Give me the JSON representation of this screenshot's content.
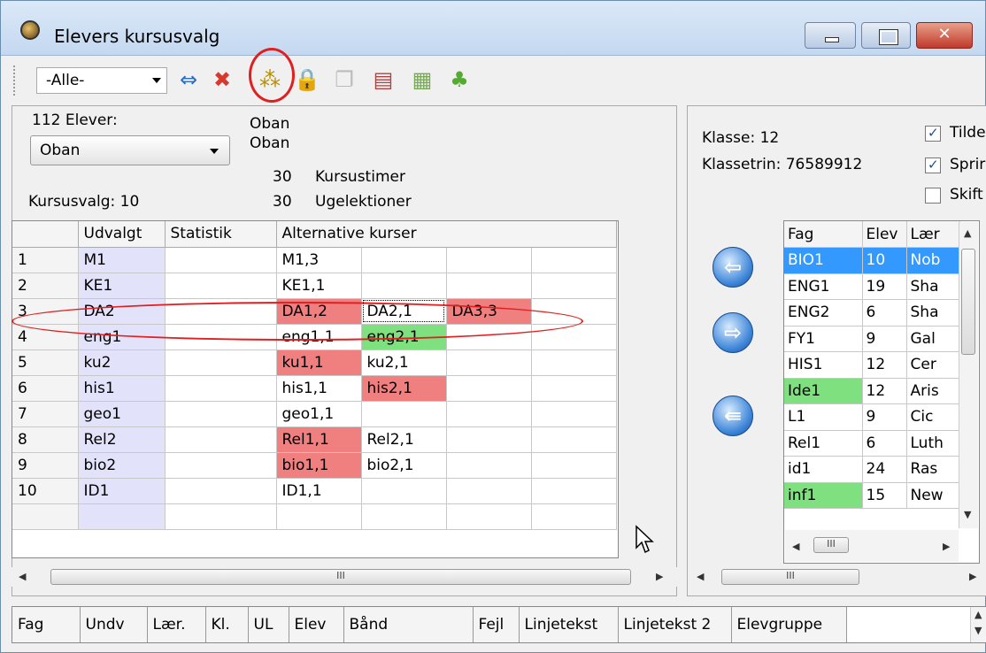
{
  "window": {
    "title": "Elevers kursusvalg",
    "close_glyph": "✕"
  },
  "toolbar": {
    "filter_value": "-Alle-",
    "icons": {
      "swap": "⇔",
      "delete": "✖",
      "stars": "⁂",
      "lock": "🔒",
      "copy": "❐",
      "filter": "▤",
      "grid": "▦",
      "users": "♣"
    }
  },
  "student": {
    "count_label": "112 Elever:",
    "name1": "Oban",
    "name2": "Oban",
    "selected": "Oban",
    "kursustimer_value": "30",
    "kursustimer_label": "Kursustimer",
    "ugelektioner_value": "30",
    "ugelektioner_label": "Ugelektioner",
    "kursusvalg": "Kursusvalg: 10"
  },
  "grid": {
    "headers": [
      "",
      "Udvalgt",
      "Statistik",
      "Alternative kurser",
      "",
      "",
      ""
    ],
    "rows": [
      {
        "n": "1",
        "udv": "M1",
        "alts": [
          {
            "t": "M1,3",
            "c": ""
          },
          {
            "t": "",
            "c": ""
          },
          {
            "t": "",
            "c": ""
          },
          {
            "t": "",
            "c": ""
          }
        ]
      },
      {
        "n": "2",
        "udv": "KE1",
        "alts": [
          {
            "t": "KE1,1",
            "c": ""
          },
          {
            "t": "",
            "c": ""
          },
          {
            "t": "",
            "c": ""
          },
          {
            "t": "",
            "c": ""
          }
        ]
      },
      {
        "n": "3",
        "udv": "DA2",
        "alts": [
          {
            "t": "DA1,2",
            "c": "red"
          },
          {
            "t": "DA2,1",
            "c": "focused"
          },
          {
            "t": "DA3,3",
            "c": "red"
          },
          {
            "t": "",
            "c": ""
          }
        ]
      },
      {
        "n": "4",
        "udv": "eng1",
        "alts": [
          {
            "t": "eng1,1",
            "c": ""
          },
          {
            "t": "eng2,1",
            "c": "green"
          },
          {
            "t": "",
            "c": ""
          },
          {
            "t": "",
            "c": ""
          }
        ]
      },
      {
        "n": "5",
        "udv": "ku2",
        "alts": [
          {
            "t": "ku1,1",
            "c": "red"
          },
          {
            "t": "ku2,1",
            "c": ""
          },
          {
            "t": "",
            "c": ""
          },
          {
            "t": "",
            "c": ""
          }
        ]
      },
      {
        "n": "6",
        "udv": "his1",
        "alts": [
          {
            "t": "his1,1",
            "c": ""
          },
          {
            "t": "his2,1",
            "c": "red"
          },
          {
            "t": "",
            "c": ""
          },
          {
            "t": "",
            "c": ""
          }
        ]
      },
      {
        "n": "7",
        "udv": "geo1",
        "alts": [
          {
            "t": "geo1,1",
            "c": ""
          },
          {
            "t": "",
            "c": ""
          },
          {
            "t": "",
            "c": ""
          },
          {
            "t": "",
            "c": ""
          }
        ]
      },
      {
        "n": "8",
        "udv": "Rel2",
        "alts": [
          {
            "t": "Rel1,1",
            "c": "red"
          },
          {
            "t": "Rel2,1",
            "c": ""
          },
          {
            "t": "",
            "c": ""
          },
          {
            "t": "",
            "c": ""
          }
        ]
      },
      {
        "n": "9",
        "udv": "bio2",
        "alts": [
          {
            "t": "bio1,1",
            "c": "red"
          },
          {
            "t": "bio2,1",
            "c": ""
          },
          {
            "t": "",
            "c": ""
          },
          {
            "t": "",
            "c": ""
          }
        ]
      },
      {
        "n": "10",
        "udv": "ID1",
        "alts": [
          {
            "t": "ID1,1",
            "c": ""
          },
          {
            "t": "",
            "c": ""
          },
          {
            "t": "",
            "c": ""
          },
          {
            "t": "",
            "c": ""
          }
        ]
      },
      {
        "n": "",
        "udv": "",
        "alts": [
          {
            "t": "",
            "c": ""
          },
          {
            "t": "",
            "c": ""
          },
          {
            "t": "",
            "c": ""
          },
          {
            "t": "",
            "c": ""
          }
        ]
      }
    ]
  },
  "scroll": {
    "left": "◀",
    "right": "▶",
    "up": "▲",
    "down": "▼",
    "thumb": "III"
  },
  "klasse": {
    "klasse": "Klasse: 12",
    "klassetrin": "Klassetrin: 76589912",
    "options": [
      {
        "label": "Tilde",
        "checked": true
      },
      {
        "label": "Sprir",
        "checked": true
      },
      {
        "label": "Skift",
        "checked": false
      }
    ]
  },
  "move_buttons": {
    "left": "⇦",
    "right": "⇨",
    "back": "⇚"
  },
  "fag": {
    "headers": [
      "Fag",
      "Elev",
      "Lær"
    ],
    "rows": [
      {
        "fag": "BIO1",
        "elev": "10",
        "laer": "Nob",
        "c": "sel"
      },
      {
        "fag": "ENG1",
        "elev": "19",
        "laer": "Sha",
        "c": ""
      },
      {
        "fag": "ENG2",
        "elev": "6",
        "laer": "Sha",
        "c": ""
      },
      {
        "fag": "FY1",
        "elev": "9",
        "laer": "Gal",
        "c": ""
      },
      {
        "fag": "HIS1",
        "elev": "12",
        "laer": "Cer",
        "c": ""
      },
      {
        "fag": "Ide1",
        "elev": "12",
        "laer": "Aris",
        "c": "green"
      },
      {
        "fag": "L1",
        "elev": "9",
        "laer": "Cic",
        "c": ""
      },
      {
        "fag": "Rel1",
        "elev": "6",
        "laer": "Luth",
        "c": ""
      },
      {
        "fag": "id1",
        "elev": "24",
        "laer": "Ras",
        "c": ""
      },
      {
        "fag": "inf1",
        "elev": "15",
        "laer": "New",
        "c": "green"
      }
    ]
  },
  "bottom": {
    "headers": [
      "Fag",
      "Undv",
      "Lær.",
      "Kl.",
      "UL",
      "Elev",
      "Bånd",
      "Fejl",
      "Linjetekst",
      "Linjetekst 2",
      "Elevgruppe"
    ]
  }
}
